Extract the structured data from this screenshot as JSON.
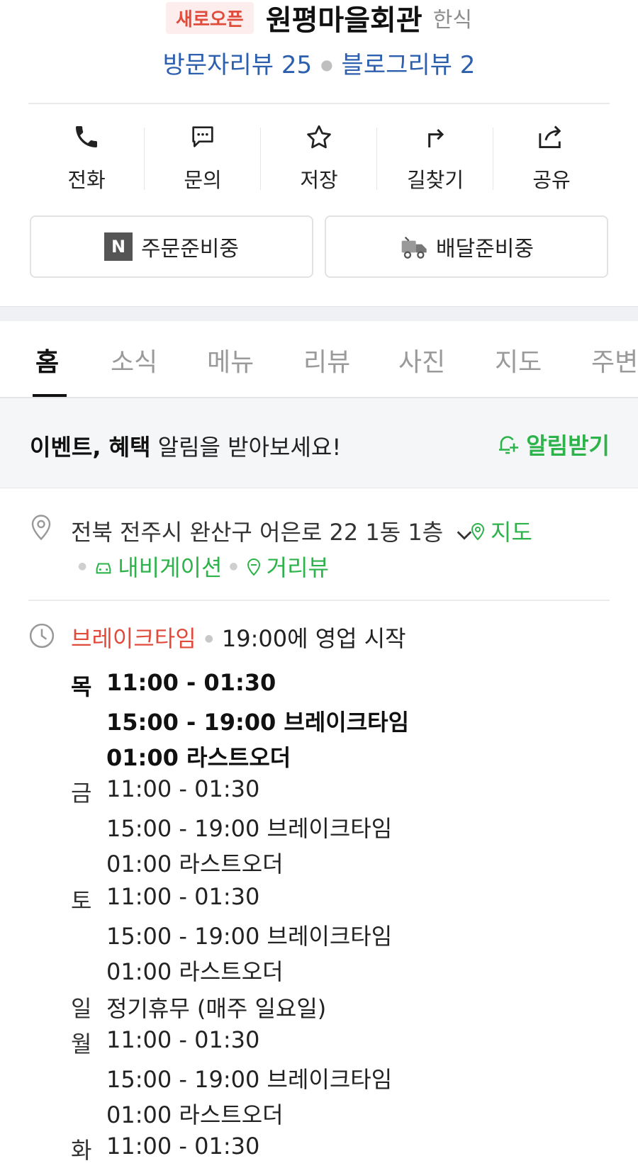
{
  "header": {
    "badge": "새로오픈",
    "store_name": "원평마을회관",
    "category": "한식",
    "visitor_review": "방문자리뷰 25",
    "blog_review": "블로그리뷰 2"
  },
  "actions": [
    {
      "label": "전화",
      "icon": "phone-icon"
    },
    {
      "label": "문의",
      "icon": "chat-icon"
    },
    {
      "label": "저장",
      "icon": "star-icon"
    },
    {
      "label": "길찾기",
      "icon": "directions-icon"
    },
    {
      "label": "공유",
      "icon": "share-icon"
    }
  ],
  "order": {
    "order_label": "주문준비중",
    "delivery_label": "배달준비중",
    "n_badge": "N"
  },
  "tabs": [
    "홈",
    "소식",
    "메뉴",
    "리뷰",
    "사진",
    "지도",
    "주변"
  ],
  "notify": {
    "bold_text": "이벤트, 혜택",
    "text": " 알림을 받아보세요!",
    "button": "알림받기"
  },
  "address": {
    "text": "전북 전주시 완산구 어은로 22 1동 1층",
    "map": "지도",
    "navigation": "내비게이션",
    "street_view": "거리뷰"
  },
  "hours": {
    "status": "브레이크타임",
    "status_detail": "19:00에 영업 시작",
    "days": [
      {
        "day": "목",
        "lines": [
          "11:00 - 01:30",
          "15:00 - 19:00 브레이크타임",
          "01:00 라스트오더"
        ]
      },
      {
        "day": "금",
        "lines": [
          "11:00 - 01:30",
          "15:00 - 19:00 브레이크타임",
          "01:00 라스트오더"
        ]
      },
      {
        "day": "토",
        "lines": [
          "11:00 - 01:30",
          "15:00 - 19:00 브레이크타임",
          "01:00 라스트오더"
        ]
      },
      {
        "day": "일",
        "lines": [
          "정기휴무 (매주 일요일)"
        ]
      },
      {
        "day": "월",
        "lines": [
          "11:00 - 01:30",
          "15:00 - 19:00 브레이크타임",
          "01:00 라스트오더"
        ]
      },
      {
        "day": "화",
        "lines": [
          "11:00 - 01:30"
        ]
      }
    ]
  },
  "colors": {
    "accent_red": "#e04b3c",
    "link_blue": "#2c5fae",
    "green": "#2cb34a"
  }
}
